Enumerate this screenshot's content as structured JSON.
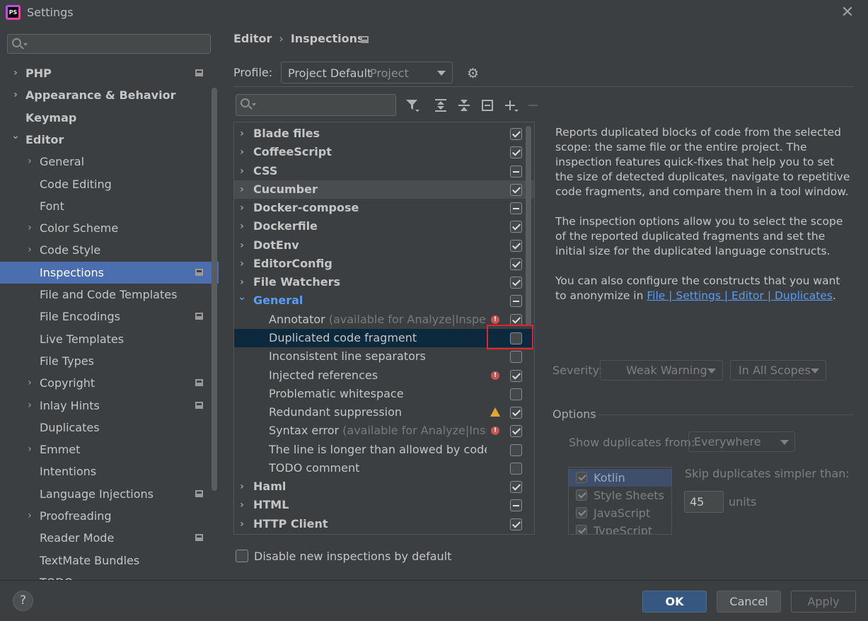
{
  "window": {
    "title": "Settings",
    "app_icon_text": "PS"
  },
  "sidebar": {
    "search_placeholder": "",
    "items": [
      {
        "label": "PHP",
        "expandable": true,
        "expanded": false,
        "bold": true,
        "page_icon": true
      },
      {
        "label": "Appearance & Behavior",
        "expandable": true,
        "expanded": false,
        "bold": true,
        "page_icon": false
      },
      {
        "label": "Keymap",
        "expandable": false,
        "bold": true,
        "page_icon": false
      },
      {
        "label": "Editor",
        "expandable": true,
        "expanded": true,
        "bold": true,
        "page_icon": false
      },
      {
        "label": "General",
        "expandable": true,
        "expanded": false,
        "bold": false,
        "page_icon": false
      },
      {
        "label": "Code Editing",
        "expandable": false,
        "bold": false,
        "page_icon": false
      },
      {
        "label": "Font",
        "expandable": false,
        "bold": false,
        "page_icon": false
      },
      {
        "label": "Color Scheme",
        "expandable": true,
        "expanded": false,
        "bold": false,
        "page_icon": false
      },
      {
        "label": "Code Style",
        "expandable": true,
        "expanded": false,
        "bold": false,
        "page_icon": false
      },
      {
        "label": "Inspections",
        "expandable": false,
        "bold": false,
        "selected": true,
        "page_icon": true
      },
      {
        "label": "File and Code Templates",
        "expandable": false,
        "bold": false,
        "page_icon": false
      },
      {
        "label": "File Encodings",
        "expandable": false,
        "bold": false,
        "page_icon": true
      },
      {
        "label": "Live Templates",
        "expandable": false,
        "bold": false,
        "page_icon": false
      },
      {
        "label": "File Types",
        "expandable": false,
        "bold": false,
        "page_icon": false
      },
      {
        "label": "Copyright",
        "expandable": true,
        "expanded": false,
        "bold": false,
        "page_icon": true
      },
      {
        "label": "Inlay Hints",
        "expandable": true,
        "expanded": false,
        "bold": false,
        "page_icon": true
      },
      {
        "label": "Duplicates",
        "expandable": false,
        "bold": false,
        "page_icon": false
      },
      {
        "label": "Emmet",
        "expandable": true,
        "expanded": false,
        "bold": false,
        "page_icon": false
      },
      {
        "label": "Intentions",
        "expandable": false,
        "bold": false,
        "page_icon": false
      },
      {
        "label": "Language Injections",
        "expandable": false,
        "bold": false,
        "page_icon": true
      },
      {
        "label": "Proofreading",
        "expandable": true,
        "expanded": false,
        "bold": false,
        "page_icon": false
      },
      {
        "label": "Reader Mode",
        "expandable": false,
        "bold": false,
        "page_icon": true
      },
      {
        "label": "TextMate Bundles",
        "expandable": false,
        "bold": false,
        "page_icon": false
      },
      {
        "label": "TODO",
        "expandable": false,
        "bold": false,
        "page_icon": false
      }
    ]
  },
  "breadcrumb": {
    "parent": "Editor",
    "separator": "›",
    "current": "Inspections"
  },
  "profile": {
    "label": "Profile:",
    "value": "Project Default",
    "scope": "Project"
  },
  "toolbar": {
    "filter_icon": "filter-icon",
    "expand_all_icon": "expand-all-icon",
    "collapse_all_icon": "collapse-all-icon",
    "reset_icon": "reset-icon",
    "add_icon": "add-icon",
    "remove_icon": "remove-icon"
  },
  "inspections": [
    {
      "label": "Blade files",
      "group": true,
      "state": "on"
    },
    {
      "label": "CoffeeScript",
      "group": true,
      "state": "on"
    },
    {
      "label": "CSS",
      "group": true,
      "state": "partial"
    },
    {
      "label": "Cucumber",
      "group": true,
      "state": "on",
      "hover": true
    },
    {
      "label": "Docker-compose",
      "group": true,
      "state": "partial"
    },
    {
      "label": "Dockerfile",
      "group": true,
      "state": "on"
    },
    {
      "label": "DotEnv",
      "group": true,
      "state": "on"
    },
    {
      "label": "EditorConfig",
      "group": true,
      "state": "on"
    },
    {
      "label": "File Watchers",
      "group": true,
      "state": "on"
    },
    {
      "label": "General",
      "group": true,
      "state": "partial",
      "expanded": true,
      "accent": true
    },
    {
      "label": "Annotator",
      "note": "(available for Analyze|Inspect Co",
      "group": false,
      "state": "on",
      "severity": "error"
    },
    {
      "label": "Duplicated code fragment",
      "group": false,
      "state": "off",
      "selected": true
    },
    {
      "label": "Inconsistent line separators",
      "group": false,
      "state": "off"
    },
    {
      "label": "Injected references",
      "group": false,
      "state": "on",
      "severity": "error"
    },
    {
      "label": "Problematic whitespace",
      "group": false,
      "state": "off"
    },
    {
      "label": "Redundant suppression",
      "group": false,
      "state": "on",
      "severity": "warning"
    },
    {
      "label": "Syntax error",
      "note": "(available for Analyze|Inspect",
      "group": false,
      "state": "on",
      "severity": "error"
    },
    {
      "label": "The line is longer than allowed by code sty",
      "group": false,
      "state": "off"
    },
    {
      "label": "TODO comment",
      "group": false,
      "state": "off"
    },
    {
      "label": "Haml",
      "group": true,
      "state": "on"
    },
    {
      "label": "HTML",
      "group": true,
      "state": "partial"
    },
    {
      "label": "HTTP Client",
      "group": true,
      "state": "on"
    }
  ],
  "description": {
    "p1": "Reports duplicated blocks of code from the selected scope: the same file or the entire project. The inspection features quick-fixes that help you to set the size of detected duplicates, navigate to repetitive code fragments, and compare them in a tool window.",
    "p2": "The inspection options allow you to select the scope of the reported duplicated fragments and set the initial size for the duplicated language constructs.",
    "p3_prefix": "You can also configure the constructs that you want to anonymize in ",
    "p3_link": "File | Settings | Editor | Duplicates",
    "p3_suffix": "."
  },
  "severity": {
    "label": "Severity:",
    "value": "Weak Warning",
    "scope": "In All Scopes"
  },
  "options": {
    "label": "Options",
    "show_dup_label": "Show duplicates from:",
    "show_dup_value": "Everywhere",
    "languages": [
      "Kotlin",
      "Style Sheets",
      "JavaScript",
      "TypeScript"
    ],
    "skip_label": "Skip duplicates simpler than:",
    "skip_value": "45",
    "units": "units"
  },
  "disable_new": {
    "label": "Disable new inspections by default",
    "checked": false
  },
  "buttons": {
    "ok": "OK",
    "cancel": "Cancel",
    "apply": "Apply",
    "help": "?"
  },
  "colors": {
    "accent": "#4b6eaf",
    "link": "#589df6",
    "group_accent": "#589df6",
    "highlight": "#e0262c"
  }
}
